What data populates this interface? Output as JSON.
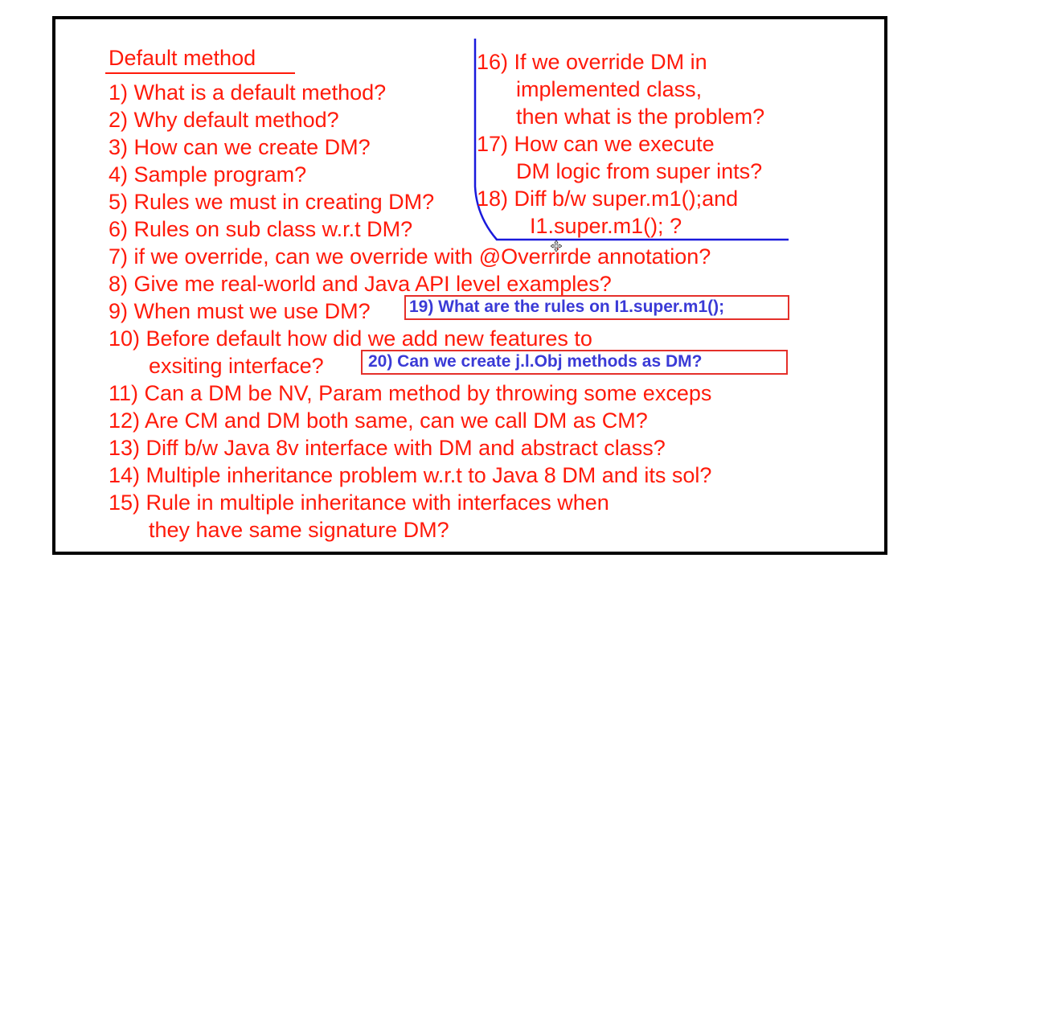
{
  "title": "Default method",
  "questions_left": [
    "1) What is a default method?",
    "2) Why default method?",
    "3) How can we create DM?",
    "4) Sample program?",
    "5) Rules we must in creating DM?",
    "6) Rules on sub class w.r.t DM?",
    "7) if we override, can we override with @Overrirde annotation?",
    "8) Give me real-world and Java API level examples?",
    "9) When must we use DM?",
    "10) Before default how did we add new features to",
    "exsiting interface?",
    "11) Can a DM be NV, Param method by throwing some exceps",
    "12) Are CM and DM both same, can we call DM as CM?",
    "13) Diff b/w Java 8v interface with DM and abstract class?",
    "14) Multiple inheritance problem w.r.t to Java 8 DM and its sol?",
    "15) Rule in multiple inheritance with interfaces when",
    "they have same signature DM?"
  ],
  "questions_right": [
    "16) If we override DM in",
    "implemented class,",
    "then what is the problem?",
    "17) How can we execute",
    "DM logic from super ints?",
    "18) Diff b/w super.m1();and",
    "I1.super.m1(); ?"
  ],
  "boxed": [
    "19) What are the rules on I1.super.m1();",
    "20) Can we create j.l.Obj methods as DM?"
  ],
  "colors": {
    "red_ink": "#ff1a0a",
    "blue_ink": "#1a1adc",
    "box_text": "#3a3ad6",
    "border": "#000000"
  },
  "icons": [
    "move-cursor-icon"
  ]
}
